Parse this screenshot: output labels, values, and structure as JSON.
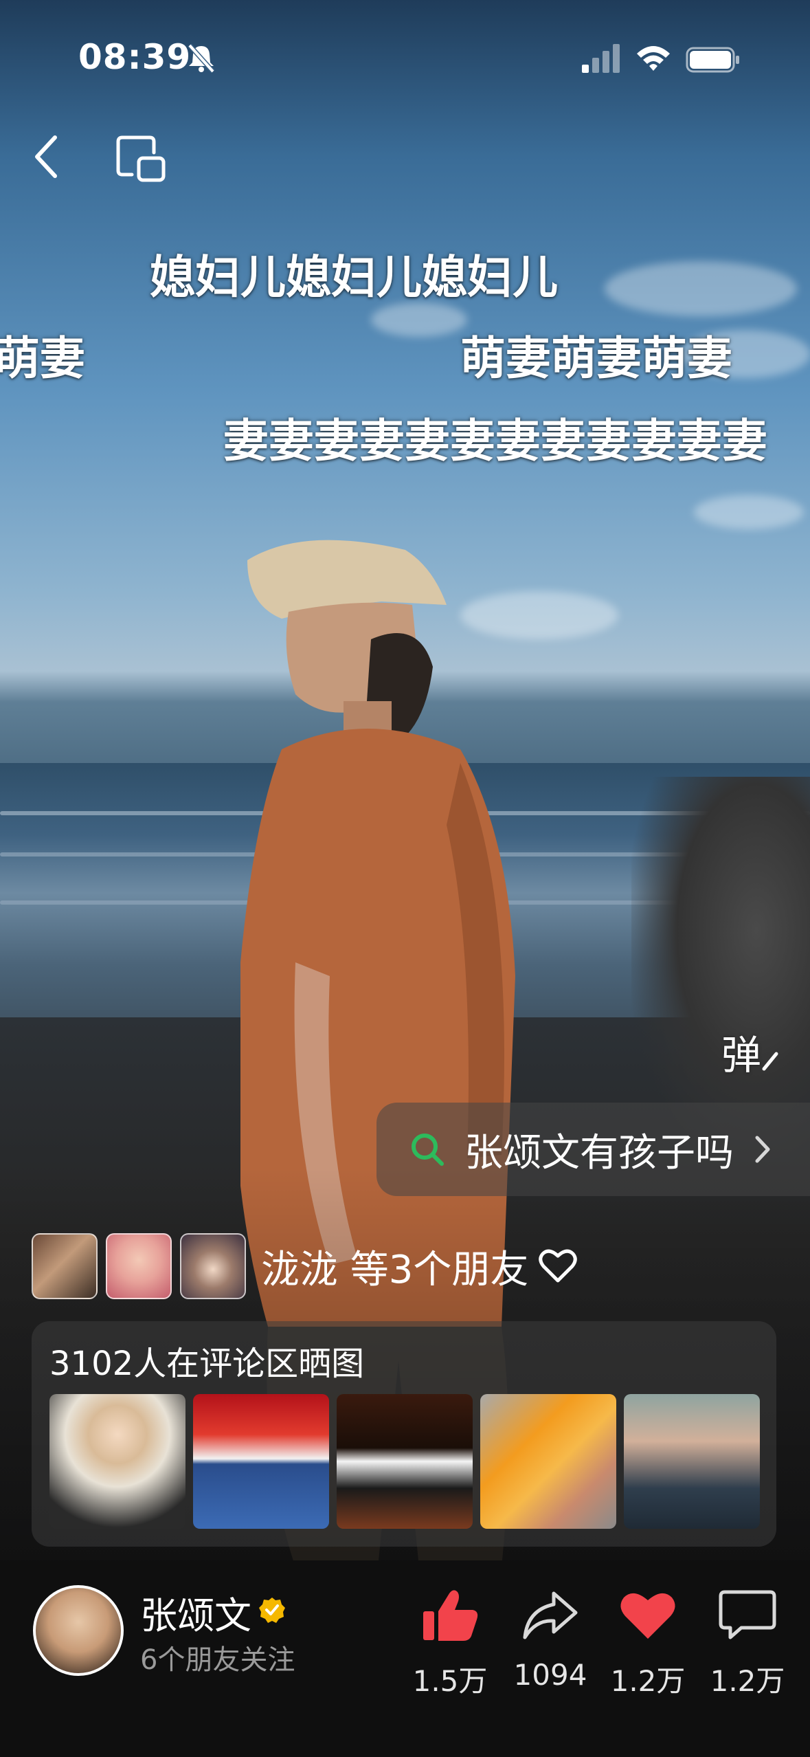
{
  "status_bar": {
    "time": "08:39",
    "icons": [
      "bell-slash-icon",
      "signal-icon",
      "wifi-icon",
      "battery-icon"
    ]
  },
  "nav": {
    "back_icon": "chevron-left-icon",
    "cast_icon": "cast-screen-icon"
  },
  "danmaku": [
    {
      "text": "媳妇儿媳妇儿媳妇儿"
    },
    {
      "text": "萌妻"
    },
    {
      "text": "萌妻萌妻萌妻"
    },
    {
      "text": "妻妻妻妻妻妻妻妻妻妻妻妻"
    }
  ],
  "danmu_toggle": "弹",
  "search": {
    "query": "张颂文有孩子吗",
    "icon": "search-icon",
    "accent": "#2dbb5c"
  },
  "friends": {
    "text": "泷泷 等3个朋友",
    "icon": "heart-outline-icon"
  },
  "gallery": {
    "title": "3102人在评论区晒图"
  },
  "author": {
    "name": "张颂文",
    "follow_info": "6个朋友关注",
    "verified_color": "#f5b800"
  },
  "actions": {
    "like": {
      "count": "1.5万",
      "color": "#f2434b"
    },
    "share": {
      "count": "1094"
    },
    "favorite": {
      "count": "1.2万",
      "color": "#f2434b"
    },
    "comment": {
      "count": "1.2万"
    }
  }
}
